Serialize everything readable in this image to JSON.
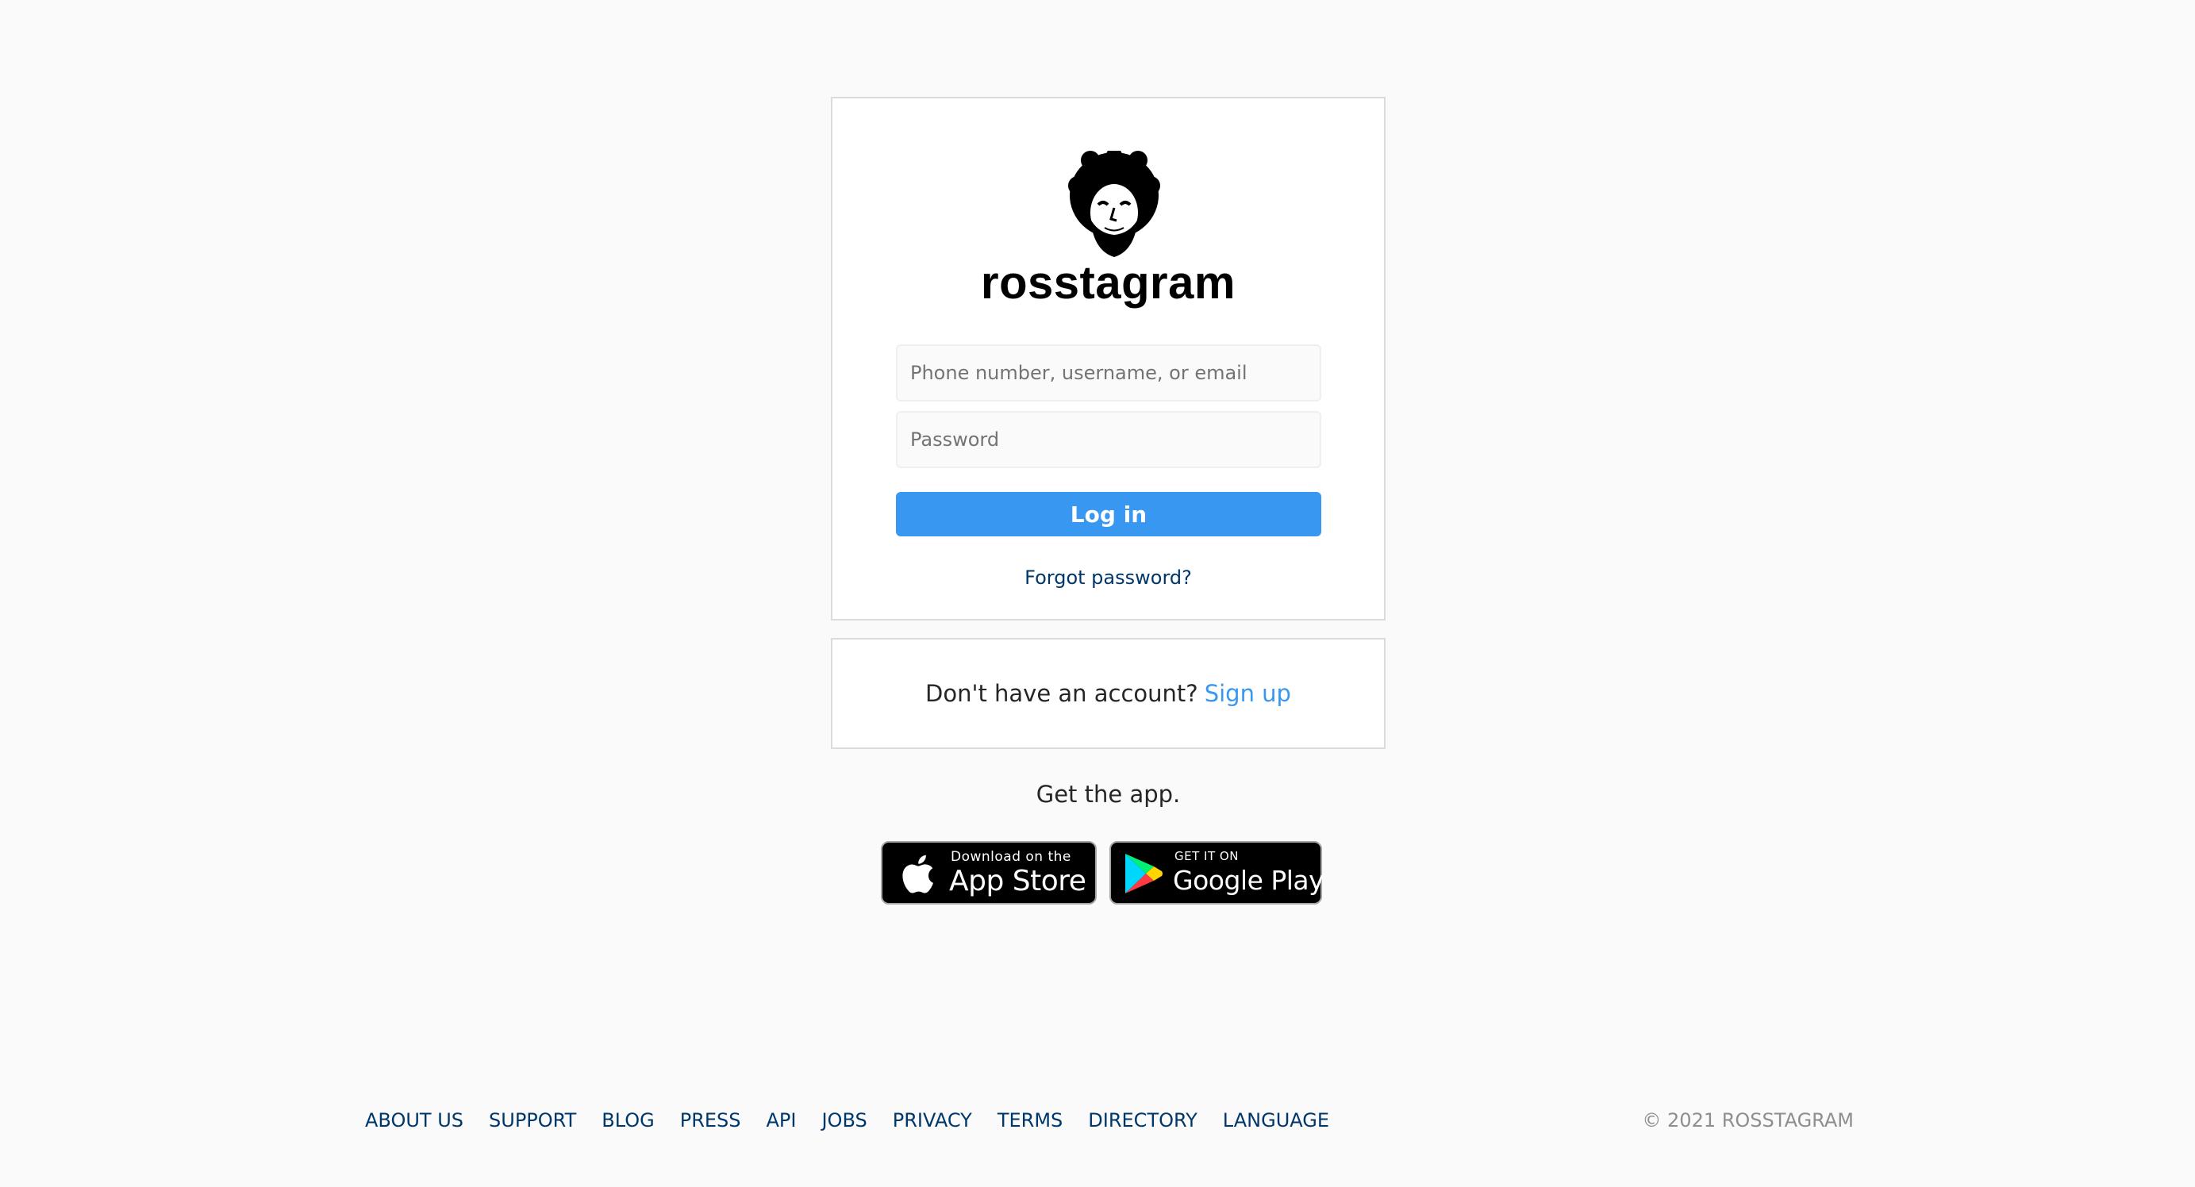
{
  "brand": {
    "name": "rosstagram",
    "logo_icon": "bob-ross-portrait-icon"
  },
  "login_form": {
    "username_placeholder": "Phone number, username, or email",
    "username_value": "",
    "password_placeholder": "Password",
    "password_value": "",
    "login_label": "Log in",
    "forgot_label": "Forgot password?"
  },
  "signup": {
    "prompt": "Don't have an account?",
    "link_label": "Sign up"
  },
  "get_app": {
    "label": "Get the app.",
    "apple": {
      "small": "Download on the",
      "big": "App Store",
      "icon": "apple-icon"
    },
    "google": {
      "small": "GET IT ON",
      "big": "Google Play",
      "icon": "google-play-icon"
    }
  },
  "footer": {
    "links": [
      "ABOUT US",
      "SUPPORT",
      "BLOG",
      "PRESS",
      "API",
      "JOBS",
      "PRIVACY",
      "TERMS",
      "DIRECTORY",
      "LANGUAGE"
    ],
    "copyright": "© 2021 ROSSTAGRAM"
  },
  "colors": {
    "background": "#fafafa",
    "primary_button": "#3897f0",
    "link_dark": "#00376b",
    "link_blue": "#3897f0",
    "border": "#dbdbdb"
  }
}
